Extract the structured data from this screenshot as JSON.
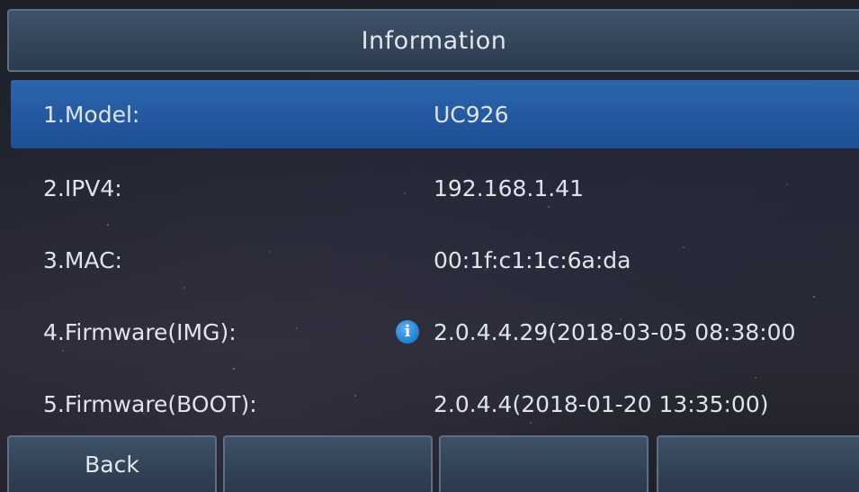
{
  "title": "Information",
  "rows": [
    {
      "label": "1.Model:",
      "value": "UC926"
    },
    {
      "label": "2.IPV4:",
      "value": "192.168.1.41"
    },
    {
      "label": "3.MAC:",
      "value": "00:1f:c1:1c:6a:da"
    },
    {
      "label": "4.Firmware(IMG):",
      "value": "2.0.4.4.29(2018-03-05 08:38:00",
      "icon": "info-icon"
    },
    {
      "label": "5.Firmware(BOOT):",
      "value": "2.0.4.4(2018-01-20 13:35:00)"
    }
  ],
  "softkeys": [
    {
      "label": "Back"
    },
    {
      "label": ""
    },
    {
      "label": ""
    },
    {
      "label": ""
    }
  ],
  "colors": {
    "selected_row": "#2c65ad",
    "bar": "#3f5268",
    "text": "#dfe3ea",
    "info_icon": "#1f7fd0"
  }
}
